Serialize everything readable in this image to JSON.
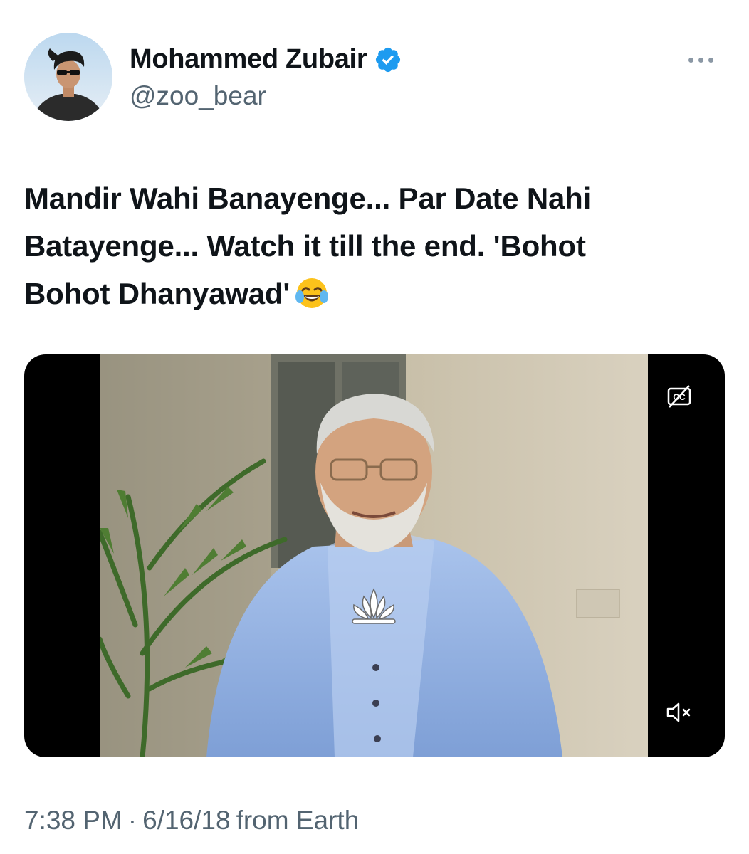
{
  "author": {
    "display_name": "Mohammed Zubair",
    "handle": "@zoo_bear",
    "verified": true,
    "verified_color": "#1d9bf0"
  },
  "tweet": {
    "text_line1": "Mandir Wahi Banayenge... Par Date Nahi",
    "text_line2": "Batayenge... Watch it till the end. 'Bohot",
    "text_line3": "Bohot Dhanyawad'",
    "emoji": "face-with-tears-of-joy-icon"
  },
  "media": {
    "type": "video",
    "captions_icon": "cc-icon",
    "mute_icon": "speaker-muted-icon"
  },
  "meta": {
    "time": "7:38 PM",
    "separator": "·",
    "date": "6/16/18",
    "source": "from Earth"
  },
  "colors": {
    "text": "#0f1419",
    "secondary": "#536471",
    "kurta": "#8fb0e2"
  }
}
